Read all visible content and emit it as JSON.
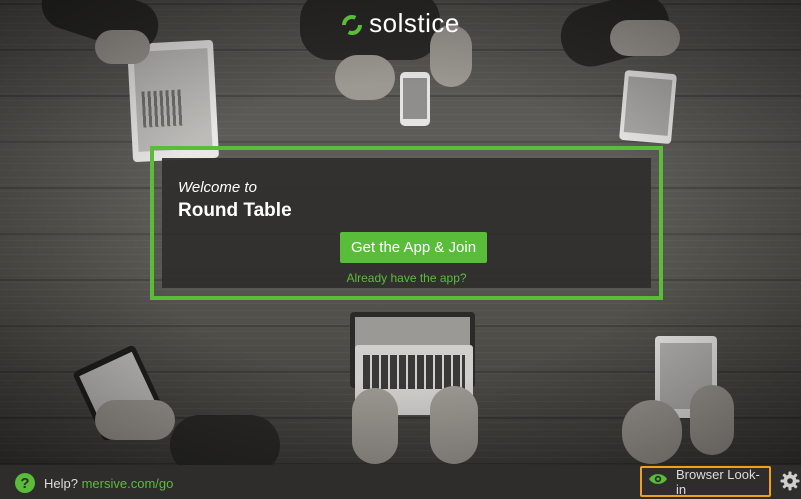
{
  "brand": {
    "name": "solstice",
    "logo_icon": "solstice-swirl-icon",
    "accent_color": "#5abd3a"
  },
  "welcome": {
    "subtitle": "Welcome to",
    "room_name": "Round Table",
    "join_button": "Get the App & Join",
    "have_app_link": "Already have the app?"
  },
  "footer": {
    "help_icon": "?",
    "help_prefix": "Help?",
    "help_link": "mersive.com/go",
    "look_in_button": "Browser Look-in",
    "look_in_icon": "eye-icon",
    "look_in_border_color": "#f0a020",
    "settings_icon": "gear-icon"
  }
}
